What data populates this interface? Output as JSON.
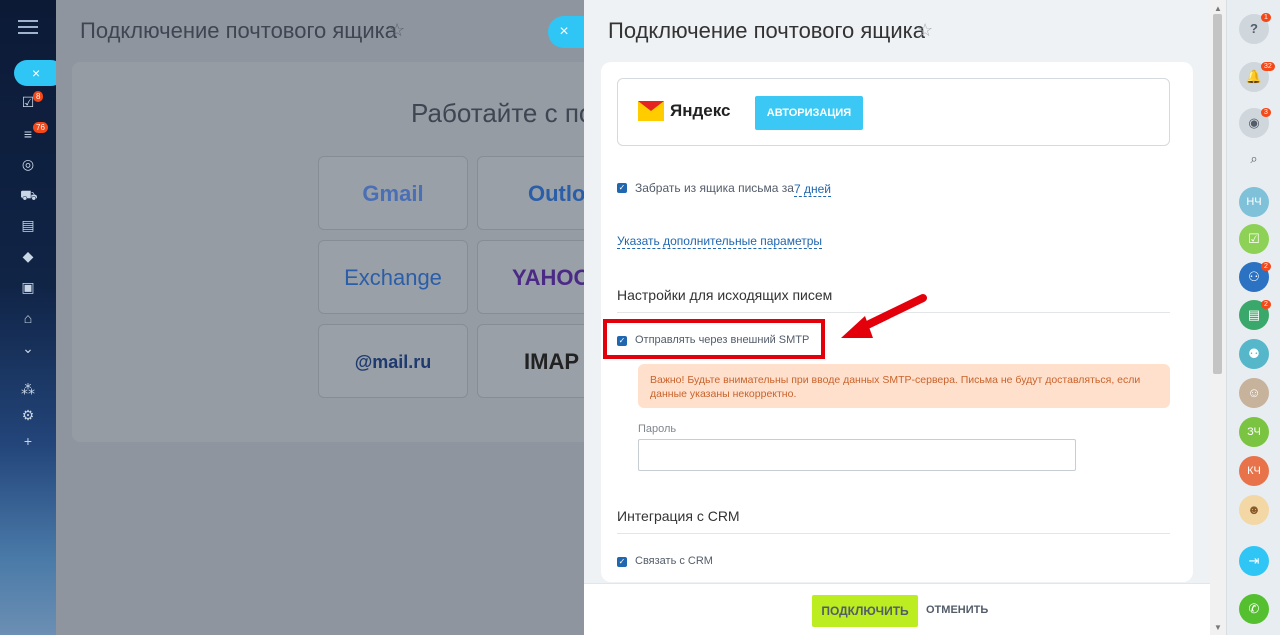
{
  "background_page": {
    "title": "Подключение почтового ящика",
    "heading": "Работайте с по",
    "close_label": "×",
    "providers": [
      "Gmail",
      "Outloo",
      "Exchange",
      "YAHOO",
      "@mail.ru",
      "IMAP"
    ]
  },
  "left_nav": {
    "badges": [
      "8",
      "76"
    ]
  },
  "slider": {
    "title": "Подключение почтового ящика",
    "provider": {
      "logo_text": "Яндекс",
      "auth_button": "АВТОРИЗАЦИЯ"
    },
    "fetch_mail": {
      "label": "Забрать из ящика письма за",
      "period": "7 дней",
      "checked": true
    },
    "advanced_link": "Указать дополнительные параметры",
    "outgoing": {
      "heading": "Настройки для исходящих писем",
      "smtp_label": "Отправлять через внешний SMTP",
      "smtp_checked": true,
      "warning": "Важно! Будьте внимательны при вводе данных SMTP-сервера. Письма не будут доставляться, если данные указаны некорректно.",
      "password_label": "Пароль",
      "password_value": ""
    },
    "crm": {
      "heading": "Интеграция с CRM",
      "link_label": "Связать с CRM",
      "checked": true
    },
    "footer": {
      "connect_button": "ПОДКЛЮЧИТЬ",
      "cancel_button": "ОТМЕНИТЬ"
    }
  },
  "right_bar": {
    "badges": {
      "help": "1",
      "notifications": "32",
      "chat": "3",
      "group": "2",
      "card": "2"
    },
    "avatars": [
      "НЧ",
      "ЗЧ",
      "КЧ"
    ]
  },
  "colors": {
    "accent": "#2fc6f6",
    "connect_button": "#bbed21",
    "highlight_frame": "#e3000b",
    "warning_bg": "#ffe0cc"
  }
}
